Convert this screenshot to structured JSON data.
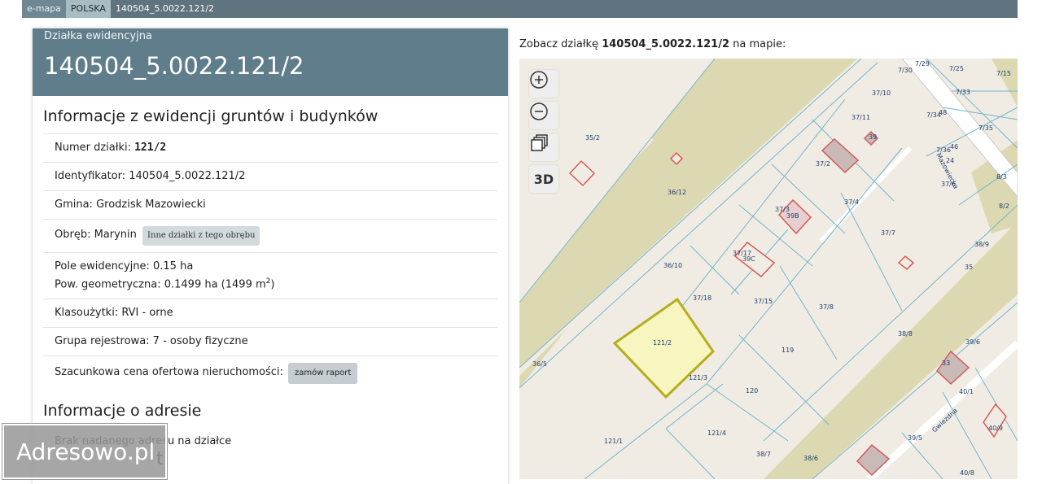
{
  "topbar": {
    "crumbs": [
      "e-mapa",
      "POLSKA",
      "140504_5.0022.121/2"
    ]
  },
  "panel": {
    "header_small": "Działka ewidencyjna",
    "header_big": "140504_5.0022.121/2",
    "section1_title": "Informacje z ewidencji gruntów i budynków",
    "rows": {
      "numer_label": "Numer działki: ",
      "numer_value": "121/2",
      "identyfikator": "Identyfikator: 140504_5.0022.121/2",
      "gmina": "Gmina: Grodzisk Mazowiecki",
      "obreb": "Obręb: Marynin",
      "obreb_button": "Inne działki z tego obrębu",
      "pole": "Pole ewidencyjne: 0.15 ha",
      "pow_prefix": "Pow. geometryczna: 0.1499 ha (1499 m",
      "pow_sup": "2",
      "pow_suffix": ")",
      "klasouzytki": "Klasoużytki: RVI - orne",
      "grupa": "Grupa rejestrowa: 7 - osoby fizyczne",
      "cena_label": "Szacunkowa cena ofertowa nieruchomości:",
      "cena_button": "zamów raport"
    },
    "section2_title": "Informacje o adresie",
    "adres_row": "Brak nadanego adresu na działce",
    "section3_tail": "t"
  },
  "watermark": "Adresowo.pl",
  "map": {
    "caption_prefix": "Zobacz działkę ",
    "caption_id": "140504_5.0022.121/2",
    "caption_suffix": " na mapie:",
    "controls": {
      "zoom_in": "+",
      "zoom_out": "−",
      "layers": "layers-icon",
      "three_d": "3D"
    },
    "labels": {
      "l_35_2": "35/2",
      "l_36_12": "36/12",
      "l_36_10": "36/10",
      "l_36_5": "36/5",
      "l_37_18": "37/18",
      "l_37_15": "37/15",
      "l_37_17": "37/17",
      "l_37_3": "37/3",
      "l_37_2": "37/2",
      "l_37_4": "37/4",
      "l_37_11": "37/11",
      "l_37_10": "37/10",
      "l_37_7": "37/7",
      "l_37_8": "37/8",
      "l_37_6": "37/6",
      "l_121_2": "121/2",
      "l_121_3": "121/3",
      "l_121_4": "121/4",
      "l_121_1": "121/1",
      "l_119": "119",
      "l_120": "120",
      "l_38_8": "38/8",
      "l_38_9": "38/9",
      "l_38_7": "38/7",
      "l_38_6": "38/6",
      "l_39_6": "39/6",
      "l_39_5": "39/5",
      "l_40_1": "40/1",
      "l_40_9": "40/9",
      "l_40_8": "40/8",
      "l_7_29": "7/29",
      "l_7_30": "7/30",
      "l_7_25": "7/25",
      "l_7_15": "7/15",
      "l_7_33": "7/33",
      "l_7_34": "7/34",
      "l_7_35": "7/35",
      "l_7_36": "7/36",
      "l_8_3": "8/3",
      "l_8_2": "8/2",
      "l_n39": "39",
      "l_n39b": "39B",
      "l_n39c": "39C",
      "l_n35": "35",
      "l_n33": "33",
      "l_n48": "48",
      "l_n46": "46",
      "l_n24": "24",
      "street1": "Mazowiecka",
      "street2": "Gwiezdna"
    }
  },
  "colors": {
    "topbar": "#5f747f",
    "header": "#5f7d8a",
    "parcel_fill": "#f7f5c0",
    "parcel_stroke": "#b5ae1c",
    "field_green": "#dcd9b2",
    "boundary": "#6fb6cf"
  }
}
